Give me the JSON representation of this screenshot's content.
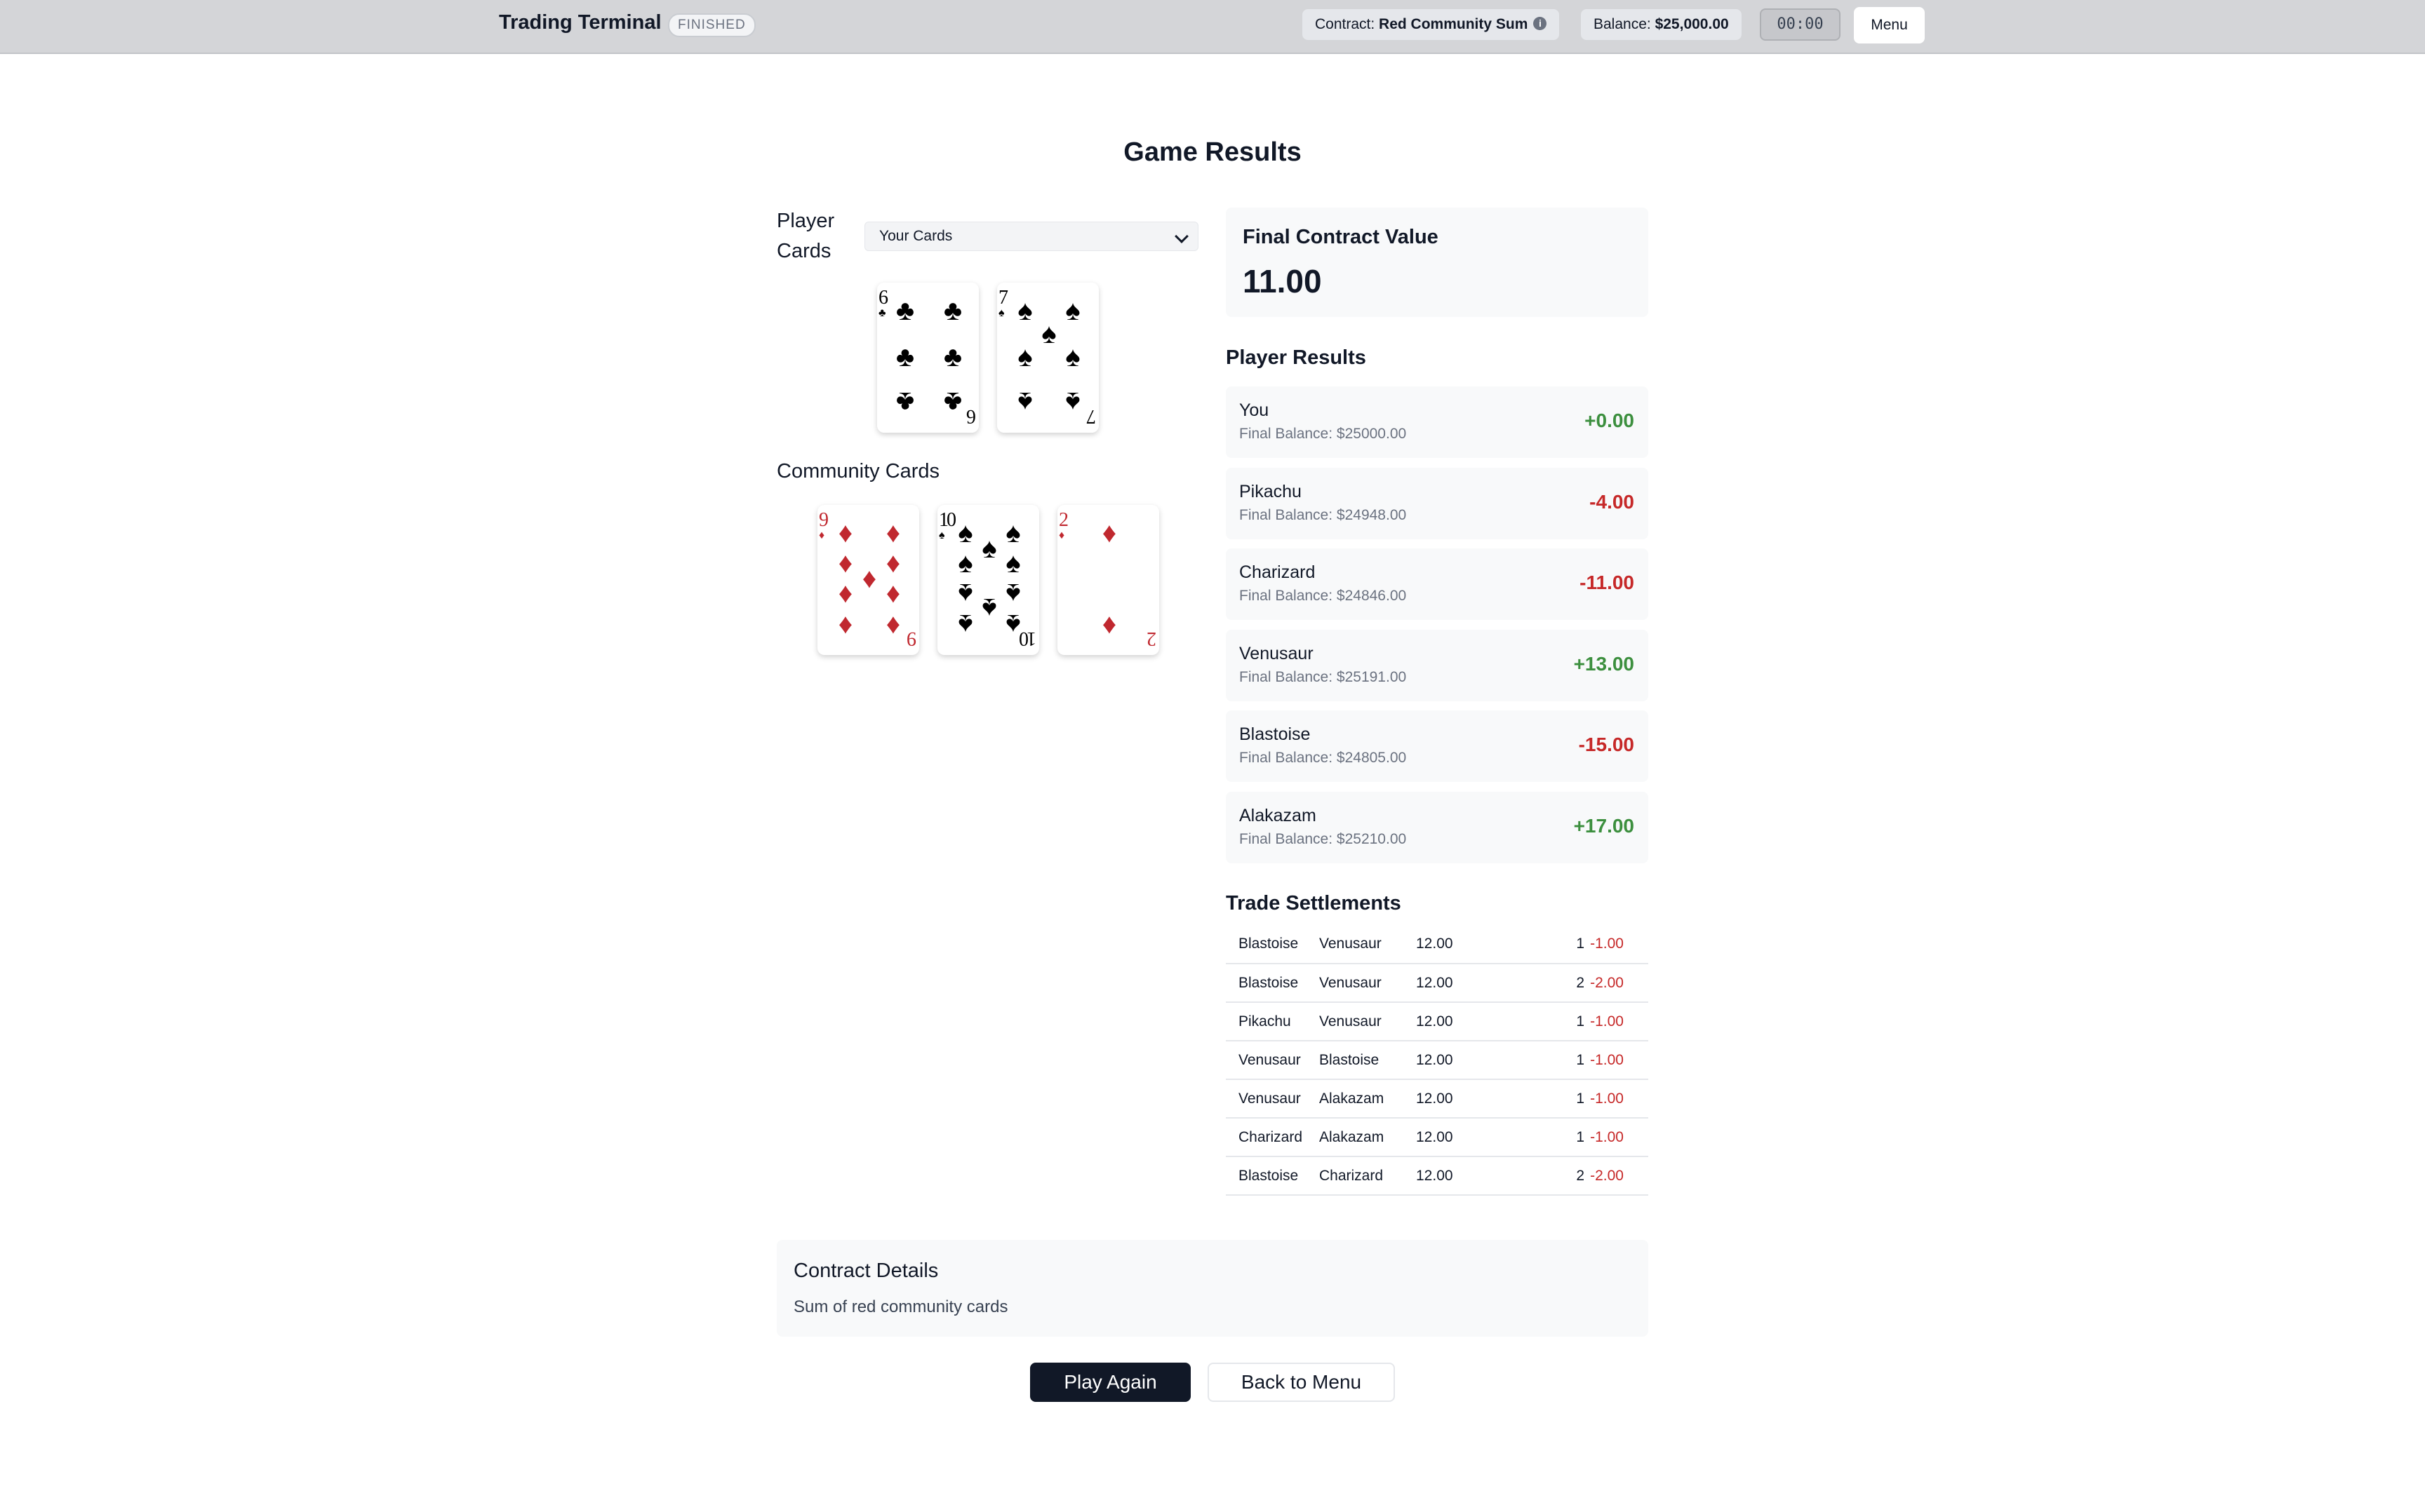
{
  "header": {
    "app_title": "Trading Terminal",
    "status": "FINISHED",
    "contract_label": "Contract:",
    "contract_value": "Red Community Sum",
    "contract_info_icon": "info-icon",
    "balance_label": "Balance:",
    "balance_value": "$25,000.00",
    "timer": "00:00",
    "menu_label": "Menu"
  },
  "page_title": "Game Results",
  "player_cards": {
    "label": "Player Cards",
    "select_value": "Your Cards",
    "cards": [
      {
        "rank": "6",
        "suit": "clubs",
        "symbol": "♣",
        "color": "#000000"
      },
      {
        "rank": "7",
        "suit": "spades",
        "symbol": "♠",
        "color": "#000000"
      }
    ]
  },
  "community_cards": {
    "label": "Community Cards",
    "cards": [
      {
        "rank": "9",
        "suit": "diamonds",
        "symbol": "♦",
        "color": "#c0282f"
      },
      {
        "rank": "10",
        "suit": "spades",
        "symbol": "♠",
        "color": "#000000"
      },
      {
        "rank": "2",
        "suit": "diamonds",
        "symbol": "♦",
        "color": "#c0282f"
      }
    ]
  },
  "final_contract": {
    "label": "Final Contract Value",
    "value": "11.00"
  },
  "player_results": {
    "title": "Player Results",
    "rows": [
      {
        "name": "You",
        "balance": "Final Balance: $25000.00",
        "pnl": "+0.00",
        "sign": "pos"
      },
      {
        "name": "Pikachu",
        "balance": "Final Balance: $24948.00",
        "pnl": "-4.00",
        "sign": "neg"
      },
      {
        "name": "Charizard",
        "balance": "Final Balance: $24846.00",
        "pnl": "-11.00",
        "sign": "neg"
      },
      {
        "name": "Venusaur",
        "balance": "Final Balance: $25191.00",
        "pnl": "+13.00",
        "sign": "pos"
      },
      {
        "name": "Blastoise",
        "balance": "Final Balance: $24805.00",
        "pnl": "-15.00",
        "sign": "neg"
      },
      {
        "name": "Alakazam",
        "balance": "Final Balance: $25210.00",
        "pnl": "+17.00",
        "sign": "pos"
      }
    ]
  },
  "trade_settlements": {
    "title": "Trade Settlements",
    "rows": [
      {
        "buyer": "Blastoise",
        "seller": "Venusaur",
        "price": "12.00",
        "qty": "1",
        "pnl": "-1.00"
      },
      {
        "buyer": "Blastoise",
        "seller": "Venusaur",
        "price": "12.00",
        "qty": "2",
        "pnl": "-2.00"
      },
      {
        "buyer": "Pikachu",
        "seller": "Venusaur",
        "price": "12.00",
        "qty": "1",
        "pnl": "-1.00"
      },
      {
        "buyer": "Venusaur",
        "seller": "Blastoise",
        "price": "12.00",
        "qty": "1",
        "pnl": "-1.00"
      },
      {
        "buyer": "Venusaur",
        "seller": "Alakazam",
        "price": "12.00",
        "qty": "1",
        "pnl": "-1.00"
      },
      {
        "buyer": "Charizard",
        "seller": "Alakazam",
        "price": "12.00",
        "qty": "1",
        "pnl": "-1.00"
      },
      {
        "buyer": "Blastoise",
        "seller": "Charizard",
        "price": "12.00",
        "qty": "2",
        "pnl": "-2.00"
      }
    ]
  },
  "contract_details": {
    "title": "Contract Details",
    "description": "Sum of red community cards"
  },
  "actions": {
    "play_again": "Play Again",
    "back_to_menu": "Back to Menu"
  },
  "colors": {
    "positive": "#3c8f3e",
    "negative": "#c62828",
    "primary_button": "#111827",
    "card_red": "#c0282f"
  }
}
